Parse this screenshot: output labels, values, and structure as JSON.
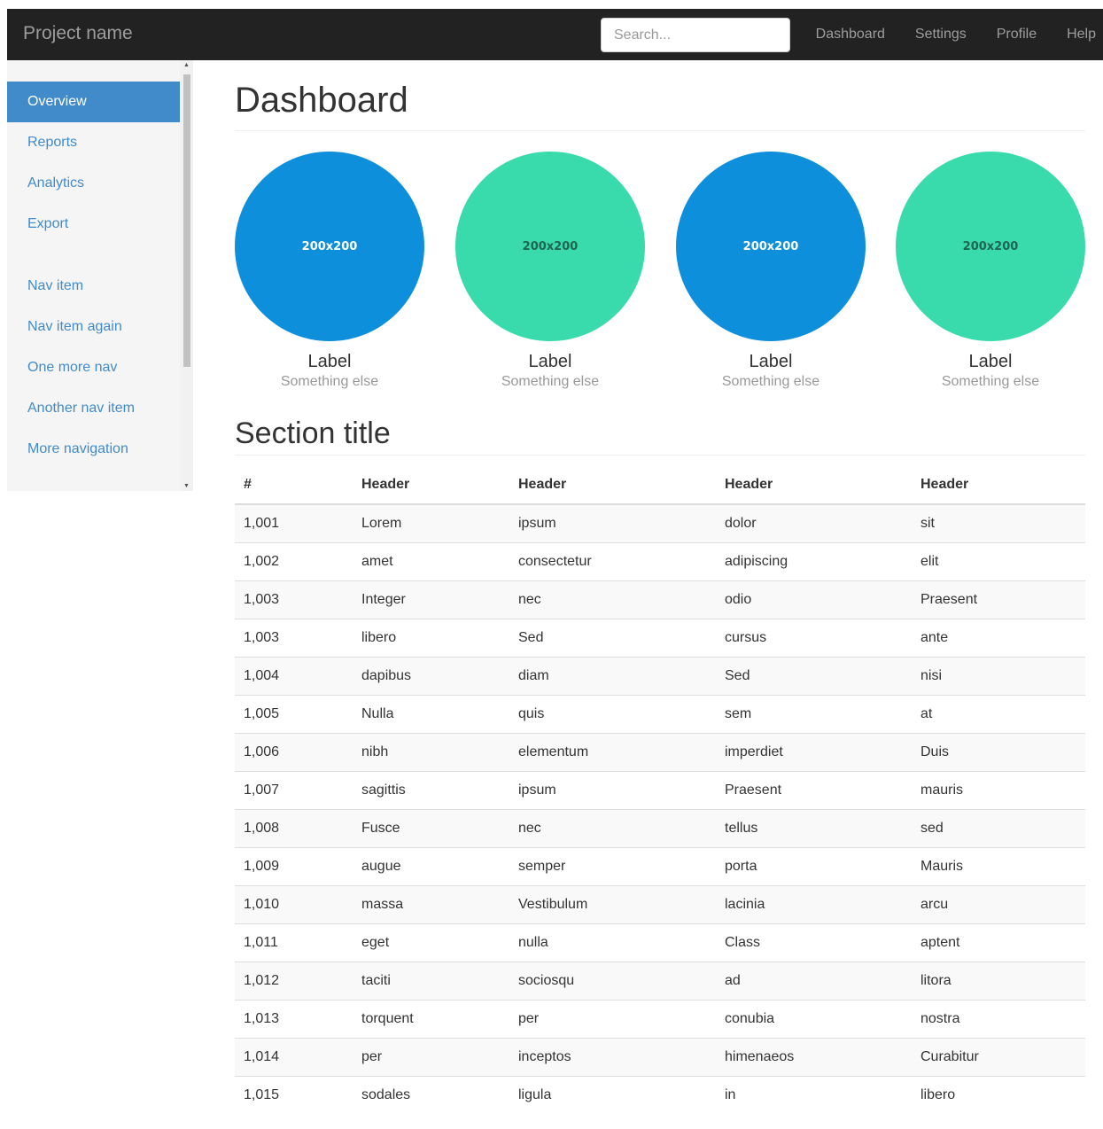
{
  "navbar": {
    "brand": "Project name",
    "search_placeholder": "Search...",
    "links": [
      "Dashboard",
      "Settings",
      "Profile",
      "Help"
    ]
  },
  "sidebar": {
    "items": [
      {
        "label": "Overview",
        "active": true
      },
      {
        "label": "Reports"
      },
      {
        "label": "Analytics"
      },
      {
        "label": "Export"
      }
    ],
    "items2": [
      {
        "label": "Nav item"
      },
      {
        "label": "Nav item again"
      },
      {
        "label": "One more nav"
      },
      {
        "label": "Another nav item"
      },
      {
        "label": "More navigation"
      }
    ]
  },
  "main": {
    "title": "Dashboard",
    "placeholders": [
      {
        "image_text": "200x200",
        "label": "Label",
        "sub": "Something else",
        "color": "#0d8fdb",
        "text_color": "#ffffff"
      },
      {
        "image_text": "200x200",
        "label": "Label",
        "sub": "Something else",
        "color": "#39dbac",
        "text_color": "#1e6651"
      },
      {
        "image_text": "200x200",
        "label": "Label",
        "sub": "Something else",
        "color": "#0d8fdb",
        "text_color": "#ffffff"
      },
      {
        "image_text": "200x200",
        "label": "Label",
        "sub": "Something else",
        "color": "#39dbac",
        "text_color": "#1e6651"
      }
    ],
    "section_title": "Section title",
    "table": {
      "headers": [
        "#",
        "Header",
        "Header",
        "Header",
        "Header"
      ],
      "rows": [
        [
          "1,001",
          "Lorem",
          "ipsum",
          "dolor",
          "sit"
        ],
        [
          "1,002",
          "amet",
          "consectetur",
          "adipiscing",
          "elit"
        ],
        [
          "1,003",
          "Integer",
          "nec",
          "odio",
          "Praesent"
        ],
        [
          "1,003",
          "libero",
          "Sed",
          "cursus",
          "ante"
        ],
        [
          "1,004",
          "dapibus",
          "diam",
          "Sed",
          "nisi"
        ],
        [
          "1,005",
          "Nulla",
          "quis",
          "sem",
          "at"
        ],
        [
          "1,006",
          "nibh",
          "elementum",
          "imperdiet",
          "Duis"
        ],
        [
          "1,007",
          "sagittis",
          "ipsum",
          "Praesent",
          "mauris"
        ],
        [
          "1,008",
          "Fusce",
          "nec",
          "tellus",
          "sed"
        ],
        [
          "1,009",
          "augue",
          "semper",
          "porta",
          "Mauris"
        ],
        [
          "1,010",
          "massa",
          "Vestibulum",
          "lacinia",
          "arcu"
        ],
        [
          "1,011",
          "eget",
          "nulla",
          "Class",
          "aptent"
        ],
        [
          "1,012",
          "taciti",
          "sociosqu",
          "ad",
          "litora"
        ],
        [
          "1,013",
          "torquent",
          "per",
          "conubia",
          "nostra"
        ],
        [
          "1,014",
          "per",
          "inceptos",
          "himenaeos",
          "Curabitur"
        ],
        [
          "1,015",
          "sodales",
          "ligula",
          "in",
          "libero"
        ]
      ]
    }
  }
}
